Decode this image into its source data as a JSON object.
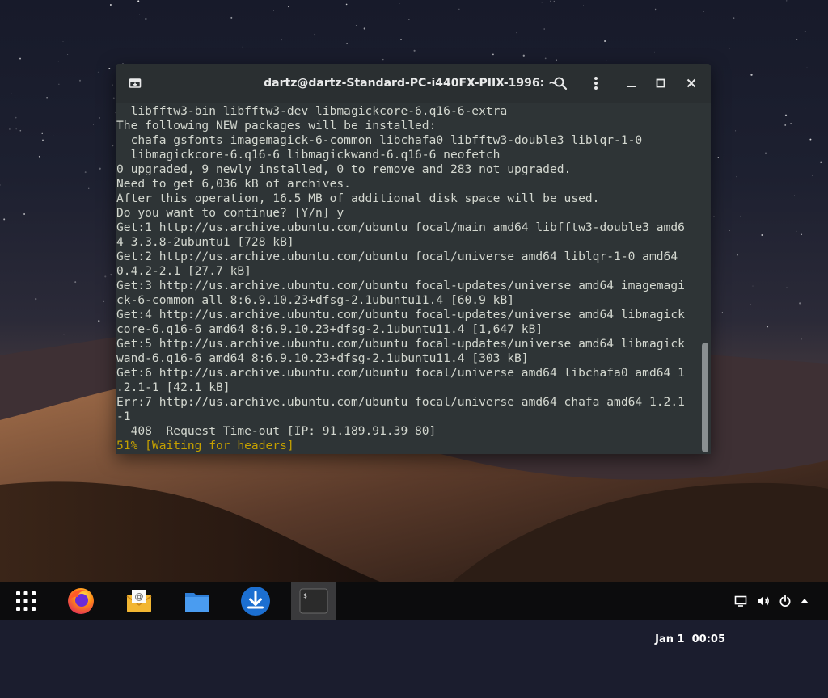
{
  "window": {
    "title": "dartz@dartz-Standard-PC-i440FX-PIIX-1996: ~",
    "buttons": [
      "new-tab",
      "search",
      "menu",
      "minimize",
      "maximize",
      "close"
    ]
  },
  "terminal": {
    "lines": [
      {
        "text": "  libfftw3-bin libfftw3-dev libmagickcore-6.q16-6-extra",
        "color": "default"
      },
      {
        "text": "The following NEW packages will be installed:",
        "color": "default"
      },
      {
        "text": "  chafa gsfonts imagemagick-6-common libchafa0 libfftw3-double3 liblqr-1-0",
        "color": "default"
      },
      {
        "text": "  libmagickcore-6.q16-6 libmagickwand-6.q16-6 neofetch",
        "color": "default"
      },
      {
        "text": "0 upgraded, 9 newly installed, 0 to remove and 283 not upgraded.",
        "color": "default"
      },
      {
        "text": "Need to get 6,036 kB of archives.",
        "color": "default"
      },
      {
        "text": "After this operation, 16.5 MB of additional disk space will be used.",
        "color": "default"
      },
      {
        "text": "Do you want to continue? [Y/n] y",
        "color": "default"
      },
      {
        "text": "Get:1 http://us.archive.ubuntu.com/ubuntu focal/main amd64 libfftw3-double3 amd6",
        "color": "default"
      },
      {
        "text": "4 3.3.8-2ubuntu1 [728 kB]",
        "color": "default"
      },
      {
        "text": "Get:2 http://us.archive.ubuntu.com/ubuntu focal/universe amd64 liblqr-1-0 amd64",
        "color": "default"
      },
      {
        "text": "0.4.2-2.1 [27.7 kB]",
        "color": "default"
      },
      {
        "text": "Get:3 http://us.archive.ubuntu.com/ubuntu focal-updates/universe amd64 imagemagi",
        "color": "default"
      },
      {
        "text": "ck-6-common all 8:6.9.10.23+dfsg-2.1ubuntu11.4 [60.9 kB]",
        "color": "default"
      },
      {
        "text": "Get:4 http://us.archive.ubuntu.com/ubuntu focal-updates/universe amd64 libmagick",
        "color": "default"
      },
      {
        "text": "core-6.q16-6 amd64 8:6.9.10.23+dfsg-2.1ubuntu11.4 [1,647 kB]",
        "color": "default"
      },
      {
        "text": "Get:5 http://us.archive.ubuntu.com/ubuntu focal-updates/universe amd64 libmagick",
        "color": "default"
      },
      {
        "text": "wand-6.q16-6 amd64 8:6.9.10.23+dfsg-2.1ubuntu11.4 [303 kB]",
        "color": "default"
      },
      {
        "text": "Get:6 http://us.archive.ubuntu.com/ubuntu focal/universe amd64 libchafa0 amd64 1",
        "color": "default"
      },
      {
        "text": ".2.1-1 [42.1 kB]",
        "color": "default"
      },
      {
        "text": "Err:7 http://us.archive.ubuntu.com/ubuntu focal/universe amd64 chafa amd64 1.2.1",
        "color": "default"
      },
      {
        "text": "-1",
        "color": "default"
      },
      {
        "text": "  408  Request Time-out [IP: 91.189.91.39 80]",
        "color": "default"
      },
      {
        "text": "51% [Waiting for headers]",
        "color": "yellow"
      }
    ]
  },
  "taskbar": {
    "apps": [
      {
        "name": "app-grid",
        "icon": "grid-icon"
      },
      {
        "name": "firefox",
        "icon": "firefox-icon"
      },
      {
        "name": "mail",
        "icon": "mail-icon"
      },
      {
        "name": "files",
        "icon": "folder-icon"
      },
      {
        "name": "downloader",
        "icon": "download-icon"
      },
      {
        "name": "terminal",
        "icon": "terminal-icon",
        "active": true
      }
    ],
    "clock": {
      "date": "Jan 1",
      "time": "00:05"
    },
    "tray": [
      "screen-icon",
      "volume-icon",
      "power-icon",
      "chevron-up-icon"
    ]
  },
  "colors": {
    "terminal_bg": "#2e3436",
    "terminal_fg": "#d3d7cf",
    "terminal_yellow": "#c4a000",
    "titlebar_bg": "#2a2f31",
    "taskbar_bg": "#0c0c0d"
  }
}
